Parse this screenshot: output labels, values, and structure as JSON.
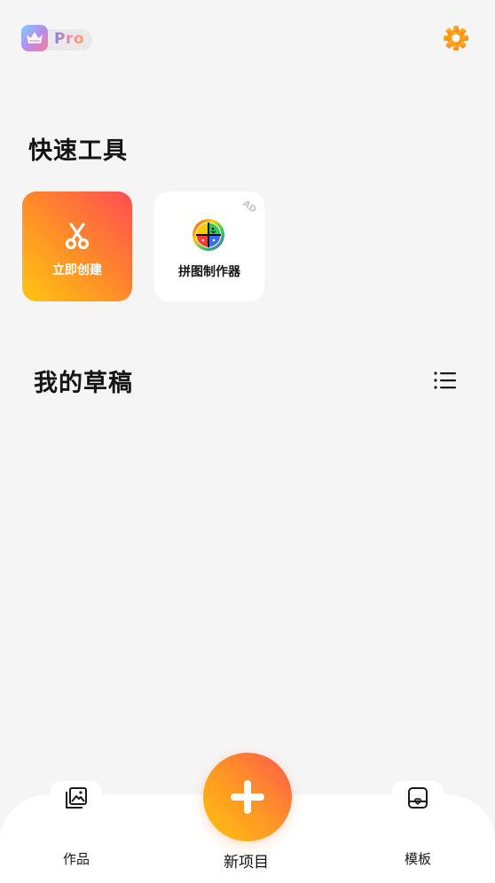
{
  "header": {
    "pro_badge": "Pro",
    "icons": {
      "crown": "crown-icon",
      "settings": "gear-icon"
    }
  },
  "quick_tools": {
    "title": "快速工具",
    "items": [
      {
        "label": "立即创建",
        "icon": "scissors-icon"
      },
      {
        "label": "拼图制作器",
        "icon": "collage-maker-icon",
        "tag": "AD"
      }
    ]
  },
  "drafts": {
    "title": "我的草稿",
    "icon": "list-view-icon"
  },
  "bottom_nav": {
    "works": {
      "label": "作品",
      "icon": "gallery-icon"
    },
    "new_project": {
      "label": "新项目",
      "icon": "plus-icon"
    },
    "templates": {
      "label": "模板",
      "icon": "template-icon"
    }
  },
  "colors": {
    "accent_orange": "#ff8a2a",
    "accent_yellow": "#ffc60f",
    "accent_red": "#ff4d53",
    "background": "#f5f5f5"
  }
}
